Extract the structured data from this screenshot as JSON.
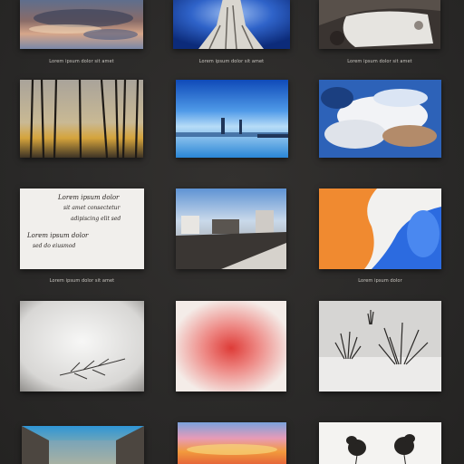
{
  "gallery": {
    "captions": {
      "r1c1": "Lorem ipsum dolor sit amet",
      "r1c2": "Lorem ipsum dolor sit amet",
      "r1c3": "Lorem ipsum dolor sit amet",
      "r3c1": "Lorem ipsum dolor sit amet",
      "r3c3": "Lorem ipsum dolor"
    },
    "letter_text": {
      "line1": "Lorem ipsum dolor",
      "line2": "sit amet consectetur",
      "line3": "adipiscing elit sed",
      "line4": "Lorem ipsum dolor",
      "line5": "sed do eiusmod"
    }
  }
}
